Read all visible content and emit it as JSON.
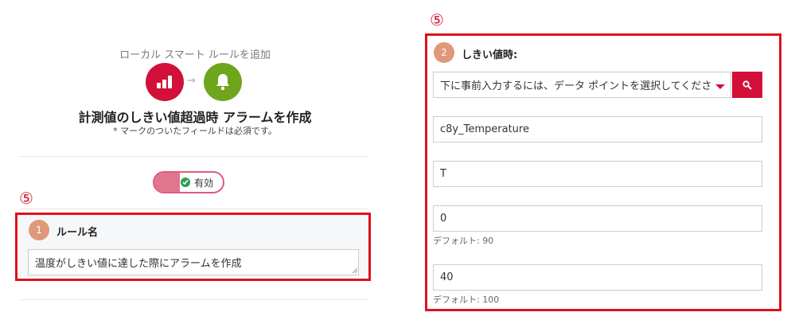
{
  "header": {
    "subtitle": "ローカル スマート ルールを追加",
    "title": "計測値のしきい値超過時 アラームを作成",
    "required_note": "* マークのついたフィールドは必須です。",
    "arrow": "→"
  },
  "icons": {
    "measurement": "bar-chart-icon",
    "alarm": "bell-icon"
  },
  "toggle": {
    "label": "有効",
    "state": "on"
  },
  "annotations": {
    "left_marker": "⑤",
    "right_marker": "⑤"
  },
  "step1": {
    "number": "1",
    "label": "ルール名",
    "value": "温度がしきい値に達した際にアラームを作成"
  },
  "step2": {
    "number": "2",
    "label": "しきい値時:",
    "datapoint_placeholder": "下に事前入力するには、データ ポイントを選択してくださ",
    "fragment": "c8y_Temperature",
    "series": "T",
    "red_value": "0",
    "red_hint": "デフォルト: 90",
    "yellow_value": "40",
    "yellow_hint": "デフォルト: 100"
  },
  "colors": {
    "brand_red": "#d2103a",
    "alarm_green": "#6fa51c",
    "highlight_red": "#e0101e",
    "step_badge": "#e0987a"
  }
}
